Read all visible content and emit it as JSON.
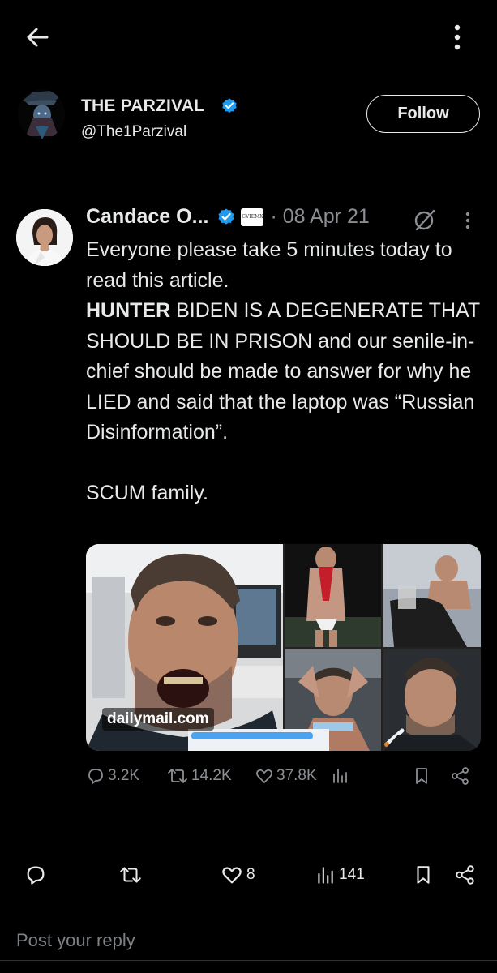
{
  "colors": {
    "background": "#000000",
    "text": "#e7e9ea",
    "muted": "#8b8f94",
    "verified": "#1d9bf0"
  },
  "topbar": {
    "back_icon": "arrow-left-icon",
    "more_icon": "more-vertical-icon"
  },
  "author": {
    "display_name": "THE PARZIVAL",
    "handle": "@The1Parzival",
    "verified": true,
    "follow_label": "Follow"
  },
  "quoted": {
    "display_name": "Candace O...",
    "affiliate_badge_text": "CVIEMX",
    "date": "· 08 Apr 21",
    "text_line1": "Everyone please take 5 minutes today to read this article.",
    "bold_word": "HUNTER",
    "text_line2_rest": " BIDEN IS A DEGENERATE THAT SHOULD BE IN PRISON and our senile-in-chief should be made to answer for why he LIED and said that the laptop was “Russian Disinformation”.",
    "text_line3": "SCUM family.",
    "media_source": "dailymail.com",
    "stats": {
      "replies": "3.2K",
      "reposts": "14.2K",
      "likes": "37.8K"
    }
  },
  "actions": {
    "likes": "8",
    "views": "141"
  },
  "reply": {
    "placeholder": "Post your reply"
  }
}
